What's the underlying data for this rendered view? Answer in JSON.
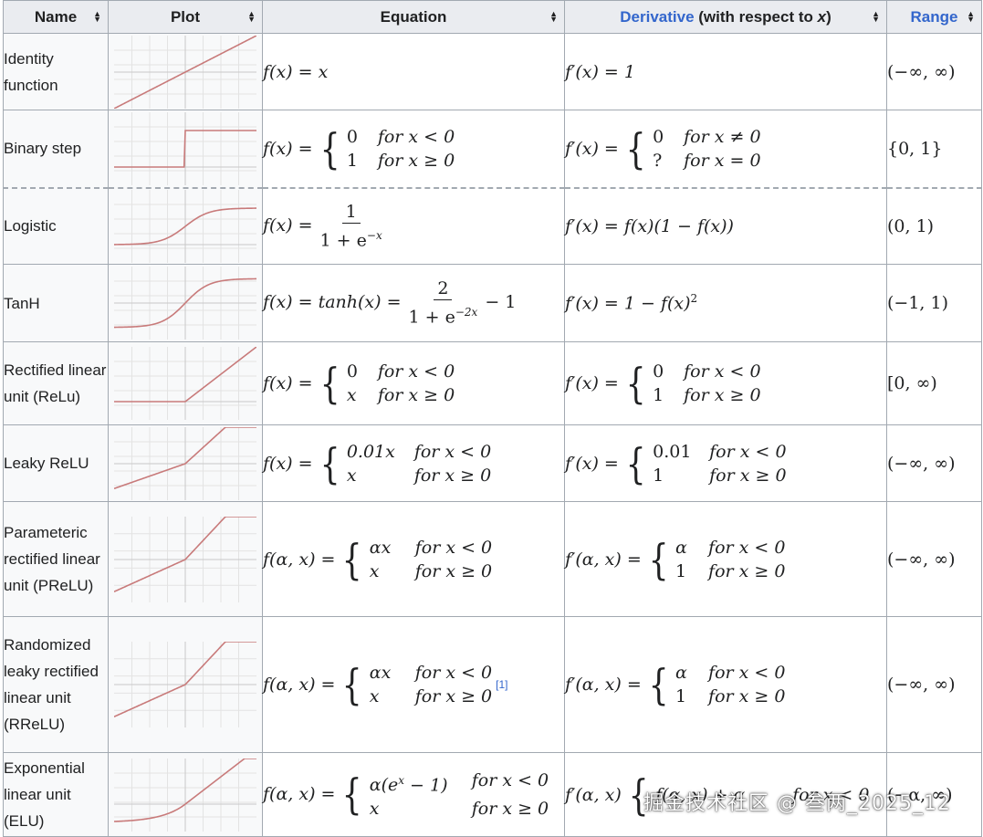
{
  "headers": {
    "name": "Name",
    "plot": "Plot",
    "equation": "Equation",
    "derivative_link": "Derivative",
    "derivative_rest": " (with respect to ",
    "derivative_var": "x",
    "derivative_end": ")",
    "range": "Range"
  },
  "rows": [
    {
      "name": "Identity function",
      "eq": {
        "lhs": "f(x) = x"
      },
      "der": {
        "lhs": "f′(x) = 1"
      },
      "range": "(−∞, ∞)"
    },
    {
      "name": "Binary step",
      "eq": {
        "lhs": "f(x) =",
        "c1v": "0",
        "c1c": "for x < 0",
        "c2v": "1",
        "c2c": "for x ≥ 0"
      },
      "der": {
        "lhs": "f′(x) =",
        "c1v": "0",
        "c1c": "for x ≠ 0",
        "c2v": "?",
        "c2c": "for x = 0"
      },
      "range": "{0, 1}"
    },
    {
      "name": "Logistic",
      "eq": {
        "lhs": "f(x) =",
        "num": "1",
        "den": "1 + e",
        "den_exp": "−x"
      },
      "der": {
        "lhs": "f′(x) = f(x)(1 − f(x))"
      },
      "range": "(0, 1)"
    },
    {
      "name": "TanH",
      "eq": {
        "lhs": "f(x) = tanh(x) =",
        "num": "2",
        "den": "1 + e",
        "den_exp": "−2x",
        "tail": "− 1"
      },
      "der": {
        "lhs": "f′(x) = 1 − f(x)",
        "exp": "2"
      },
      "range": "(−1, 1)"
    },
    {
      "name": "Rectified linear unit (ReLu)",
      "eq": {
        "lhs": "f(x) =",
        "c1v": "0",
        "c1c": "for x < 0",
        "c2v": "x",
        "c2c": "for x ≥ 0"
      },
      "der": {
        "lhs": "f′(x) =",
        "c1v": "0",
        "c1c": "for x < 0",
        "c2v": "1",
        "c2c": "for x ≥ 0"
      },
      "range": "[0, ∞)"
    },
    {
      "name": "Leaky ReLU",
      "eq": {
        "lhs": "f(x) =",
        "c1v": "0.01x",
        "c1c": "for x < 0",
        "c2v": "x",
        "c2c": "for x ≥ 0"
      },
      "der": {
        "lhs": "f′(x) =",
        "c1v": "0.01",
        "c1c": "for x < 0",
        "c2v": "1",
        "c2c": "for x ≥ 0"
      },
      "range": "(−∞, ∞)"
    },
    {
      "name": "Parameteric rectified linear unit (PReLU)",
      "eq": {
        "lhs": "f(α, x) =",
        "c1v": "αx",
        "c1c": "for x < 0",
        "c2v": "x",
        "c2c": "for x ≥ 0"
      },
      "der": {
        "lhs": "f′(α, x) =",
        "c1v": "α",
        "c1c": "for x < 0",
        "c2v": "1",
        "c2c": "for x ≥ 0"
      },
      "range": "(−∞, ∞)"
    },
    {
      "name": "Randomized leaky rectified linear unit (RReLU)",
      "eq": {
        "lhs": "f(α, x) =",
        "c1v": "αx",
        "c1c": "for x < 0",
        "c2v": "x",
        "c2c": "for x ≥ 0",
        "ref": "[1]"
      },
      "der": {
        "lhs": "f′(α, x) =",
        "c1v": "α",
        "c1c": "for x < 0",
        "c2v": "1",
        "c2c": "for x ≥ 0"
      },
      "range": "(−∞, ∞)"
    },
    {
      "name": "Exponential linear unit (ELU)",
      "eq": {
        "lhs": "f(α, x) =",
        "c1v": "α(e",
        "c1v_exp": "x",
        "c1v_tail": " − 1)",
        "c1c": "for x < 0",
        "c2v": "x",
        "c2c": "for x ≥ 0"
      },
      "der": {
        "lhs": "f′(α, x)",
        "c1v": "f(α, x) + α",
        "c1c": "for x < 0",
        "c2v": "",
        "c2c": ""
      },
      "range": "(−α, ∞)"
    }
  ],
  "watermark": "掘金技术社区 @ 叁两_2025_12",
  "colors": {
    "header_bg": "#eaecf0",
    "border": "#a2a9b1",
    "link": "#3366cc",
    "curve": "#c87a7a",
    "grid": "#e3e3e3"
  }
}
